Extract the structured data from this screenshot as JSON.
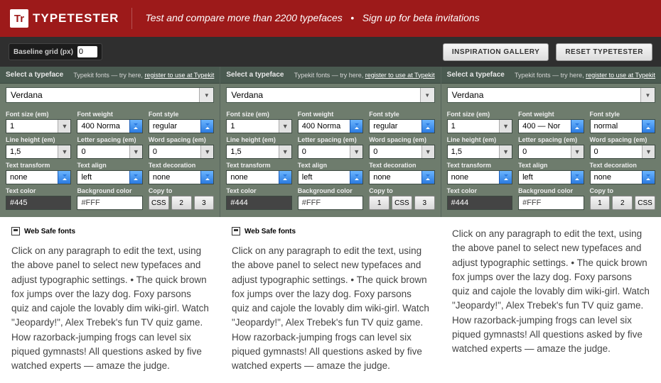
{
  "header": {
    "brand": "TYPETESTER",
    "tagline_a": "Test and compare more than 2200 typefaces",
    "tagline_b": "Sign up for beta invitations"
  },
  "toolbar": {
    "baseline_label": "Baseline grid (px)",
    "baseline_value": "0",
    "inspiration": "INSPIRATION GALLERY",
    "reset": "RESET TYPETESTER"
  },
  "panel_labels": {
    "select": "Select a typeface",
    "typekit_pre": "Typekit fonts — try here, ",
    "typekit_link": "register to use at Typekit",
    "font_size": "Font size (em)",
    "font_weight": "Font weight",
    "font_style": "Font style",
    "line_height": "Line height (em)",
    "letter_spacing": "Letter spacing (em)",
    "word_spacing": "Word spacing (em)",
    "text_transform": "Text transform",
    "text_align": "Text align",
    "text_decoration": "Text decoration",
    "text_color": "Text color",
    "bg_color": "Background color",
    "copy_to": "Copy to"
  },
  "columns": [
    {
      "typeface": "Verdana",
      "font_size": "1",
      "font_weight": "400 Norma",
      "font_style": "regular",
      "line_height": "1,5",
      "letter_spacing": "0",
      "word_spacing": "0",
      "text_transform": "none",
      "text_align": "left",
      "text_decoration": "none",
      "text_color": "#445",
      "bg_color": "#FFF",
      "copy": [
        "CSS",
        "2",
        "3"
      ],
      "websafe": "Web Safe fonts"
    },
    {
      "typeface": "Verdana",
      "font_size": "1",
      "font_weight": "400 Norma",
      "font_style": "regular",
      "line_height": "1,5",
      "letter_spacing": "0",
      "word_spacing": "0",
      "text_transform": "none",
      "text_align": "left",
      "text_decoration": "none",
      "text_color": "#444",
      "bg_color": "#FFF",
      "copy": [
        "1",
        "CSS",
        "3"
      ],
      "websafe": "Web Safe fonts"
    },
    {
      "typeface": "Verdana",
      "font_size": "1",
      "font_weight": "400 — Nor",
      "font_style": "normal",
      "line_height": "1,5",
      "letter_spacing": "0",
      "word_spacing": "0",
      "text_transform": "none",
      "text_align": "left",
      "text_decoration": "none",
      "text_color": "#444",
      "bg_color": "#FFF",
      "copy": [
        "1",
        "2",
        "CSS"
      ],
      "websafe": ""
    }
  ],
  "sample_text": "Click on any paragraph to edit the text, using the above panel to select new typefaces and adjust typographic settings. • The quick brown fox jumps over the lazy dog. Foxy parsons quiz and cajole the lovably dim wiki-girl. Watch \"Jeopardy!\", Alex Trebek's fun TV quiz game. How razorback-jumping frogs can level six piqued gymnasts! All questions asked by five watched experts — amaze the judge."
}
